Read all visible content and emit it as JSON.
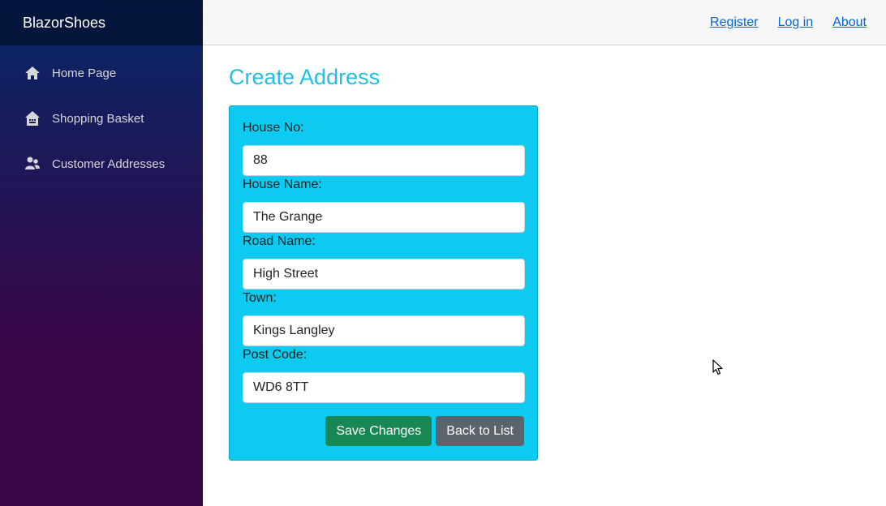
{
  "brand": "BlazorShoes",
  "sidebar": {
    "items": [
      {
        "label": "Home Page",
        "icon": "home-icon"
      },
      {
        "label": "Shopping Basket",
        "icon": "basket-icon"
      },
      {
        "label": "Customer Addresses",
        "icon": "people-icon"
      }
    ]
  },
  "topnav": {
    "links": [
      "Register",
      "Log in",
      "About"
    ]
  },
  "page": {
    "title": "Create Address"
  },
  "form": {
    "fields": [
      {
        "label": "House No:",
        "value": "88"
      },
      {
        "label": "House Name:",
        "value": "The Grange"
      },
      {
        "label": "Road Name:",
        "value": "High Street"
      },
      {
        "label": "Town:",
        "value": "Kings Langley"
      },
      {
        "label": "Post Code:",
        "value": "WD6 8TT"
      }
    ],
    "save_label": "Save Changes",
    "back_label": "Back to List"
  },
  "colors": {
    "accent_title": "#1ec1e0",
    "form_background": "#0dcaf0",
    "save_button": "#198754",
    "back_button": "#5c636a",
    "link": "#0366d6"
  }
}
